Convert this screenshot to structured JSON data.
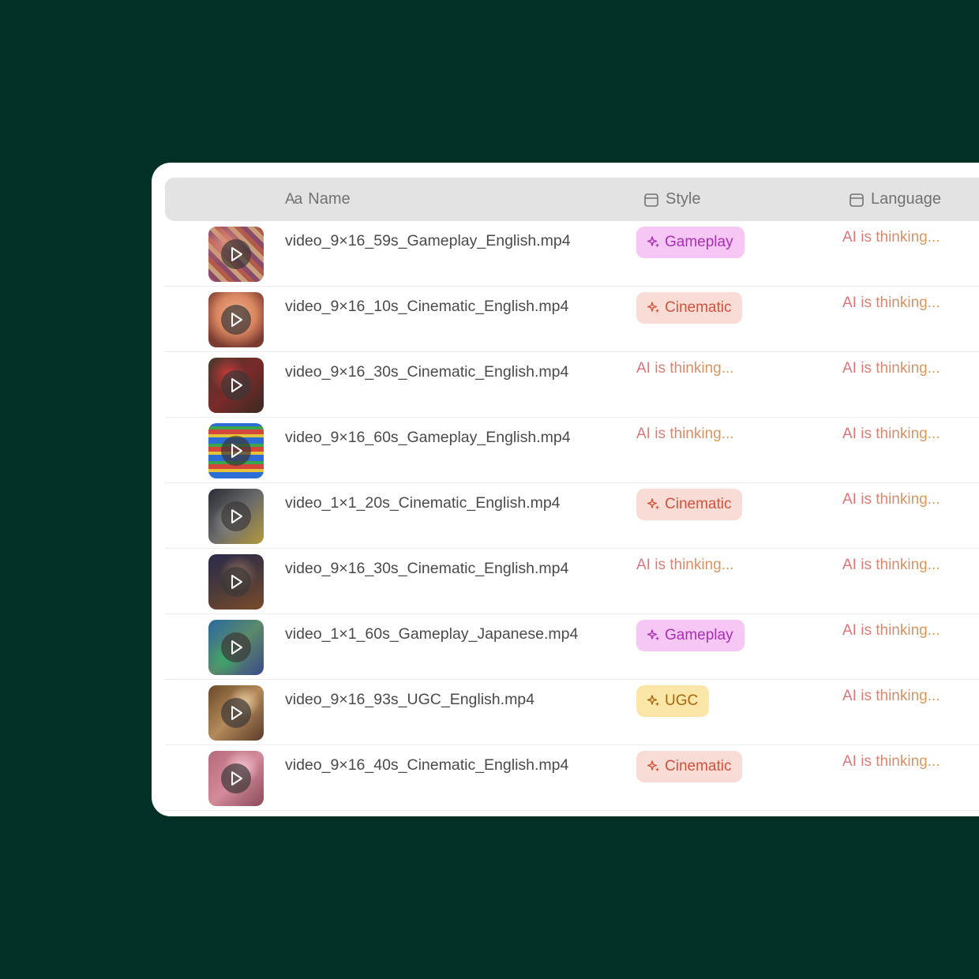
{
  "colors": {
    "background": "#023027",
    "gameplay_bg": "#f6c6f4",
    "gameplay_fg": "#a92fb5",
    "cinematic_bg": "#fadcd6",
    "cinematic_fg": "#d1533b",
    "ugc_bg": "#fae6a6",
    "ugc_fg": "#a8660f",
    "thinking_start": "#e26f7a",
    "thinking_end": "#d4a055"
  },
  "table": {
    "headers": {
      "name_prefix": "Aa",
      "name": "Name",
      "style": "Style",
      "language": "Language"
    },
    "rows": [
      {
        "file": "video_9×16_59s_Gameplay_English.mp4",
        "style": "Gameplay",
        "style_kind": "gameplay",
        "language": "AI is thinking...",
        "thumb": "tribal-pattern"
      },
      {
        "file": "video_9×16_10s_Cinematic_English.mp4",
        "style": "Cinematic",
        "style_kind": "cinematic",
        "language": "AI is thinking...",
        "thumb": "character-face"
      },
      {
        "file": "video_9×16_30s_Cinematic_English.mp4",
        "style": "AI is thinking...",
        "style_kind": "thinking",
        "language": "AI is thinking...",
        "thumb": "festive-scene"
      },
      {
        "file": "video_9×16_60s_Gameplay_English.mp4",
        "style": "AI is thinking...",
        "style_kind": "thinking",
        "language": "AI is thinking...",
        "thumb": "puzzle-board"
      },
      {
        "file": "video_1×1_20s_Cinematic_English.mp4",
        "style": "Cinematic",
        "style_kind": "cinematic",
        "language": "AI is thinking...",
        "thumb": "dark-room"
      },
      {
        "file": "video_9×16_30s_Cinematic_English.mp4",
        "style": "AI is thinking...",
        "style_kind": "thinking",
        "language": "AI is thinking...",
        "thumb": "night-table"
      },
      {
        "file": "video_1×1_60s_Gameplay_Japanese.mp4",
        "style": "Gameplay",
        "style_kind": "gameplay",
        "language": "AI is thinking...",
        "thumb": "arena-game"
      },
      {
        "file": "video_9×16_93s_UGC_English.mp4",
        "style": "UGC",
        "style_kind": "ugc",
        "language": "AI is thinking...",
        "thumb": "people-selfie"
      },
      {
        "file": "video_9×16_40s_Cinematic_English.mp4",
        "style": "Cinematic",
        "style_kind": "cinematic",
        "language": "AI is thinking...",
        "thumb": "pink-glow"
      }
    ]
  }
}
